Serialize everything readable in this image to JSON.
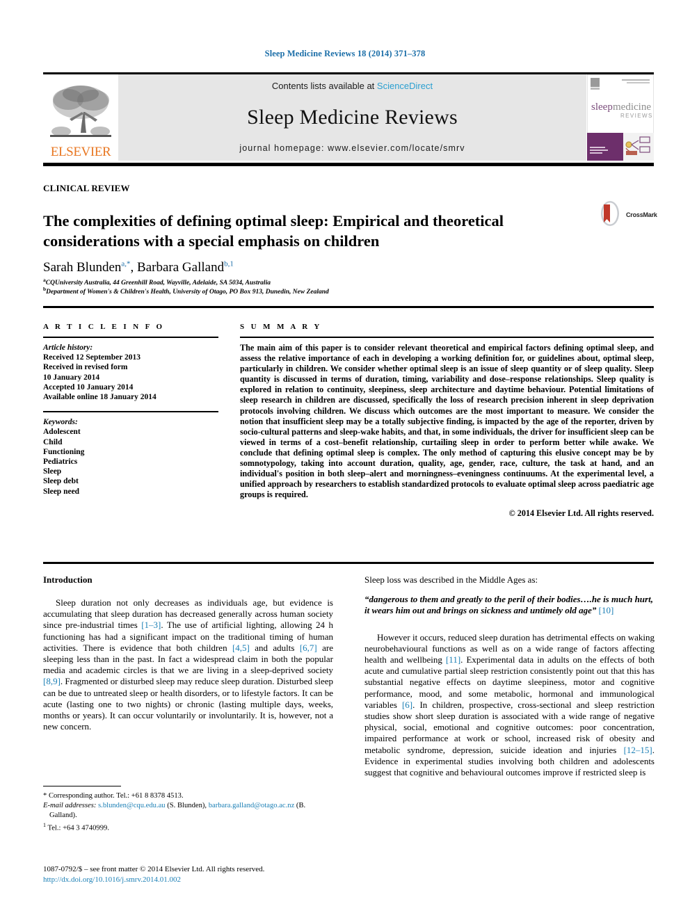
{
  "running_head": "Sleep Medicine Reviews 18 (2014) 371–378",
  "masthead": {
    "elsevier_wordmark": "ELSEVIER",
    "contents_prefix": "Contents lists available at ",
    "sciencedirect": "ScienceDirect",
    "journal_title": "Sleep Medicine Reviews",
    "homepage": "journal homepage: www.elsevier.com/locate/smrv",
    "cover_title_line1": "sleepmedicine",
    "cover_title_line2": "REVIEWS",
    "accent_link": "#2a9fd0",
    "elsevier_orange": "#e87722"
  },
  "article": {
    "category": "CLINICAL REVIEW",
    "title": "The complexities of defining optimal sleep: Empirical and theoretical considerations with a special emphasis on children",
    "crossmark_label": "CrossMark",
    "authors_html": "Sarah Blunden<sup>a,*</sup>, Barbara Galland<sup>b,1</sup>",
    "affiliations": [
      {
        "marker": "a",
        "text": "CQUniversity Australia, 44 Greenhill Road, Wayville, Adelaide, SA 5034, Australia"
      },
      {
        "marker": "b",
        "text": "Department of Women's & Children's Health, University of Otago, PO Box 913, Dunedin, New Zealand"
      }
    ]
  },
  "info": {
    "heading": "A R T I C L E   I N F O",
    "history_label": "Article history:",
    "history": [
      "Received 12 September 2013",
      "Received in revised form",
      "10 January 2014",
      "Accepted 10 January 2014",
      "Available online 18 January 2014"
    ],
    "keywords_label": "Keywords:",
    "keywords": [
      "Adolescent",
      "Child",
      "Functioning",
      "Pediatrics",
      "Sleep",
      "Sleep debt",
      "Sleep need"
    ]
  },
  "summary": {
    "heading": "S U M M A R Y",
    "text": "The main aim of this paper is to consider relevant theoretical and empirical factors defining optimal sleep, and assess the relative importance of each in developing a working definition for, or guidelines about, optimal sleep, particularly in children. We consider whether optimal sleep is an issue of sleep quantity or of sleep quality. Sleep quantity is discussed in terms of duration, timing, variability and dose–response relationships. Sleep quality is explored in relation to continuity, sleepiness, sleep architecture and daytime behaviour. Potential limitations of sleep research in children are discussed, specifically the loss of research precision inherent in sleep deprivation protocols involving children. We discuss which outcomes are the most important to measure. We consider the notion that insufficient sleep may be a totally subjective finding, is impacted by the age of the reporter, driven by socio-cultural patterns and sleep-wake habits, and that, in some individuals, the driver for insufficient sleep can be viewed in terms of a cost–benefit relationship, curtailing sleep in order to perform better while awake. We conclude that defining optimal sleep is complex. The only method of capturing this elusive concept may be by somnotypology, taking into account duration, quality, age, gender, race, culture, the task at hand, and an individual's position in both sleep–alert and morningness–eveningness continuums. At the experimental level, a unified approach by researchers to establish standardized protocols to evaluate optimal sleep across paediatric age groups is required.",
    "copyright": "© 2014 Elsevier Ltd. All rights reserved."
  },
  "body": {
    "left_heading": "Introduction",
    "left_para_1_a": "Sleep duration not only decreases as individuals age, but evidence is accumulating that sleep duration has decreased generally across human society since pre-industrial times ",
    "left_para_1_r1": "[1–3]",
    "left_para_1_b": ". The use of artificial lighting, allowing 24 h functioning has had a significant impact on the traditional timing of human activities. There is evidence that both children ",
    "left_para_1_r2": "[4,5]",
    "left_para_1_c": " and adults ",
    "left_para_1_r3": "[6,7]",
    "left_para_1_d": " are sleeping less than in the past. In fact a widespread claim in both the popular media and academic circles is that we are living in a sleep-deprived society ",
    "left_para_1_r4": "[8,9]",
    "left_para_1_e": ". Fragmented or disturbed sleep may reduce sleep duration. Disturbed sleep can be due to untreated sleep or health disorders, or to lifestyle factors. It can be acute (lasting one to two nights) or chronic (lasting multiple days, weeks, months or years). It can occur voluntarily or involuntarily. It is, however, not a new concern.",
    "right_lead": "Sleep loss was described in the Middle Ages as:",
    "right_quote": "“dangerous to them and greatly to the peril of their bodies….he is much hurt, it wears him out and brings on sickness and untimely old age” ",
    "right_quote_ref": "[10]",
    "right_para_a": "However it occurs, reduced sleep duration has detrimental effects on waking neurobehavioural functions as well as on a wide range of factors affecting health and wellbeing ",
    "right_para_r1": "[11]",
    "right_para_b": ". Experimental data in adults on the effects of both acute and cumulative partial sleep restriction consistently point out that this has substantial negative effects on daytime sleepiness, motor and cognitive performance, mood, and some metabolic, hormonal and immunological variables ",
    "right_para_r2": "[6]",
    "right_para_c": ". In children, prospective, cross-sectional and sleep restriction studies show short sleep duration is associated with a wide range of negative physical, social, emotional and cognitive outcomes: poor concentration, impaired performance at work or school, increased risk of obesity and metabolic syndrome, depression, suicide ideation and injuries ",
    "right_para_r3": "[12–15]",
    "right_para_d": ". Evidence in experimental studies involving both children and adolescents suggest that cognitive and behavioural outcomes improve if restricted sleep is"
  },
  "footnotes": {
    "corresponding": "* Corresponding author. Tel.: +61 8 8378 4513.",
    "email_label": "E-mail addresses:",
    "email_1": "s.blunden@cqu.edu.au",
    "email_1_who": " (S. Blunden), ",
    "email_2": "barbara.galland@otago.ac.nz",
    "email_2_who": " (B. Galland).",
    "note_1_marker": "1",
    "note_1": " Tel.: +64 3 4740999."
  },
  "colophon": {
    "issn_line": "1087-0792/$ – see front matter © 2014 Elsevier Ltd. All rights reserved.",
    "doi": "http://dx.doi.org/10.1016/j.smrv.2014.01.002"
  }
}
